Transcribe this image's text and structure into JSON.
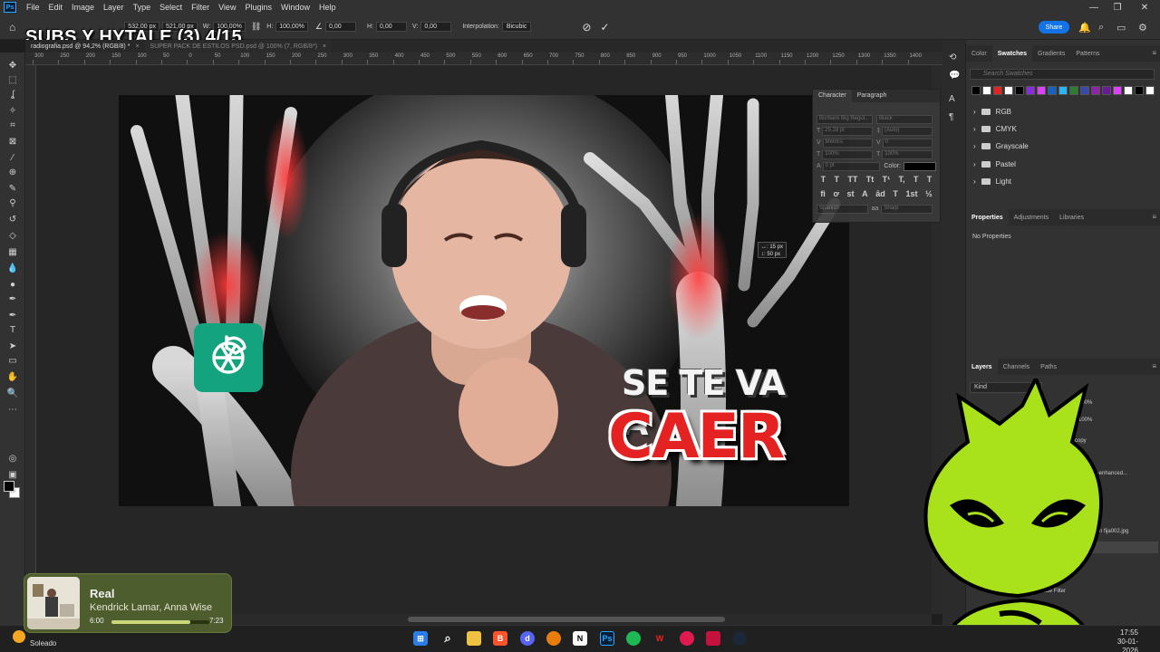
{
  "menu": [
    "File",
    "Edit",
    "Image",
    "Layer",
    "Type",
    "Select",
    "Filter",
    "View",
    "Plugins",
    "Window",
    "Help"
  ],
  "app_logo": "Ps",
  "options": {
    "w_label": "W:",
    "w_value": "100,00%",
    "h_label": "H:",
    "h_value": "100,00%",
    "angle_value": "0,00",
    "hskew_label": "H:",
    "hskew_value": "0,00",
    "vskew_label": "V:",
    "vskew_value": "0,00",
    "interp_label": "Interpolation:",
    "interp_value": "Bicubic",
    "x_value": "532,00 px",
    "y_value": "521,00 px"
  },
  "share_label": "Share",
  "overlay_title": "SUBS Y HYTALE (3) 4/15",
  "tabs": [
    {
      "label": "radiografia.psd @ 94,2% (RGB/8) *"
    },
    {
      "label": "SUPER PACK DE ESTILOS PSD.psd @ 100% (7, RGB/8*)"
    }
  ],
  "ruler_marks": [
    "300",
    "250",
    "200",
    "150",
    "100",
    "50",
    "0",
    "50",
    "100",
    "150",
    "200",
    "250",
    "300",
    "350",
    "400",
    "450",
    "500",
    "550",
    "600",
    "650",
    "700",
    "750",
    "800",
    "850",
    "900",
    "950",
    "1000",
    "1050",
    "1100",
    "1150",
    "1200",
    "1250",
    "1300",
    "1350",
    "1400"
  ],
  "thumbnail": {
    "line1": "SE TE VA A",
    "line2": "CAER"
  },
  "measure": {
    "line1": "↔: 15 px",
    "line2": "↕: 50 px"
  },
  "character_panel": {
    "tabs": [
      "Character",
      "Paragraph"
    ],
    "font": "Burbank Big Regul...",
    "style": "Black",
    "size": "25,28 pt",
    "leading": "(Auto)",
    "kerning": "Metrics",
    "tracking": "0",
    "vscale": "100%",
    "hscale": "100%",
    "baseline": "0 pt",
    "color_label": "Color:",
    "glyphs": [
      "T",
      "T",
      "TT",
      "Tt",
      "T¹",
      "T,",
      "T",
      "T"
    ],
    "glyphs2": [
      "fi",
      "ơ",
      "st",
      "A",
      "ād",
      "T",
      "1st",
      "½"
    ],
    "language": "Spanish",
    "aa_label": "aa",
    "aa_value": "Sharp"
  },
  "swatches_panel": {
    "tabs": [
      "Color",
      "Swatches",
      "Gradients",
      "Patterns"
    ],
    "search_placeholder": "Search Swatches",
    "colors": [
      "#000000",
      "#ffffff",
      "#e52222",
      "#ffffff",
      "#000000",
      "#8a2be2",
      "#e040fb",
      "#1565c0",
      "#29b6f6",
      "#2e7d32",
      "#3949ab",
      "#8e24aa",
      "#6a1b9a",
      "#e040fb",
      "#ffffff",
      "#000000",
      "#ffffff"
    ],
    "folders": [
      "RGB",
      "CMYK",
      "Grayscale",
      "Pastel",
      "Light"
    ]
  },
  "properties_panel": {
    "tabs": [
      "Properties",
      "Adjustments",
      "Libraries"
    ],
    "empty_label": "No Properties"
  },
  "layers_panel": {
    "tabs": [
      "Layers",
      "Channels",
      "Paths"
    ],
    "kind_label": "Kind",
    "opacity": "100%",
    "fill": "100%",
    "rows": [
      "copy",
      "0..._mini-enhanced...",
      "",
      "30.Imagen fija002.jpg",
      "",
      "Smart Filters",
      "Camera Raw Filter",
      "..."
    ]
  },
  "music": {
    "title": "Real",
    "artist": "Kendrick Lamar, Anna Wise",
    "elapsed": "6:00",
    "total": "7:23",
    "progress": 0.81
  },
  "weather": {
    "label": "Soleado"
  },
  "clock": {
    "time": "17:55",
    "date": "30-01-2026"
  },
  "taskbar_icons": [
    "windows-start",
    "search",
    "file-explorer",
    "brave",
    "discord",
    "blender",
    "notion",
    "photoshop",
    "spotify",
    "app-w",
    "app-red",
    "steam"
  ]
}
